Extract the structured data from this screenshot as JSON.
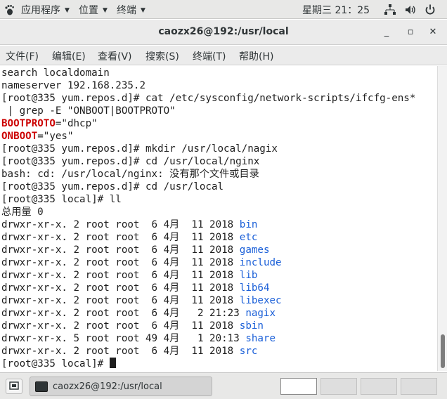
{
  "topbar": {
    "applications": "应用程序",
    "places": "位置",
    "terminal_app": "终端",
    "clock": "星期三 21：25",
    "icons": [
      "network-icon",
      "volume-icon",
      "power-icon"
    ]
  },
  "window": {
    "title": "caozx26@192:/usr/local",
    "minimize": "_",
    "maximize": "▫",
    "close": "✕"
  },
  "menubar": {
    "file": "文件(F)",
    "edit": "编辑(E)",
    "view": "查看(V)",
    "search": "搜索(S)",
    "terminal": "终端(T)",
    "help": "帮助(H)"
  },
  "terminal": {
    "lines": [
      {
        "text": "search localdomain"
      },
      {
        "text": "nameserver 192.168.235.2"
      },
      {
        "text": "[root@335 yum.repos.d]# cat /etc/sysconfig/network-scripts/ifcfg-ens*"
      },
      {
        "text": " | grep -E \"ONBOOT|BOOTPROTO\""
      },
      {
        "key": "BOOTPROTO",
        "rest": "=\"dhcp\""
      },
      {
        "key": "ONBOOT",
        "rest": "=\"yes\""
      },
      {
        "text": "[root@335 yum.repos.d]# mkdir /usr/local/nagix"
      },
      {
        "text": "[root@335 yum.repos.d]# cd /usr/local/nginx"
      },
      {
        "text": "bash: cd: /usr/local/nginx: 没有那个文件或目录"
      },
      {
        "text": "[root@335 yum.repos.d]# cd /usr/local"
      },
      {
        "text": "[root@335 local]# ll"
      },
      {
        "text": "总用量 0"
      },
      {
        "perm": "drwxr-xr-x. 2 root root  6 4月  11 2018 ",
        "name": "bin"
      },
      {
        "perm": "drwxr-xr-x. 2 root root  6 4月  11 2018 ",
        "name": "etc"
      },
      {
        "perm": "drwxr-xr-x. 2 root root  6 4月  11 2018 ",
        "name": "games"
      },
      {
        "perm": "drwxr-xr-x. 2 root root  6 4月  11 2018 ",
        "name": "include"
      },
      {
        "perm": "drwxr-xr-x. 2 root root  6 4月  11 2018 ",
        "name": "lib"
      },
      {
        "perm": "drwxr-xr-x. 2 root root  6 4月  11 2018 ",
        "name": "lib64"
      },
      {
        "perm": "drwxr-xr-x. 2 root root  6 4月  11 2018 ",
        "name": "libexec"
      },
      {
        "perm": "drwxr-xr-x. 2 root root  6 4月   2 21:23 ",
        "name": "nagix"
      },
      {
        "perm": "drwxr-xr-x. 2 root root  6 4月  11 2018 ",
        "name": "sbin"
      },
      {
        "perm": "drwxr-xr-x. 5 root root 49 4月   1 20:13 ",
        "name": "share"
      },
      {
        "perm": "drwxr-xr-x. 2 root root  6 4月  11 2018 ",
        "name": "src"
      },
      {
        "text": "[root@335 local]# "
      }
    ]
  },
  "taskbar": {
    "task_label": "caozx26@192:/usr/local",
    "workspaces": 4,
    "active_workspace": 1
  }
}
